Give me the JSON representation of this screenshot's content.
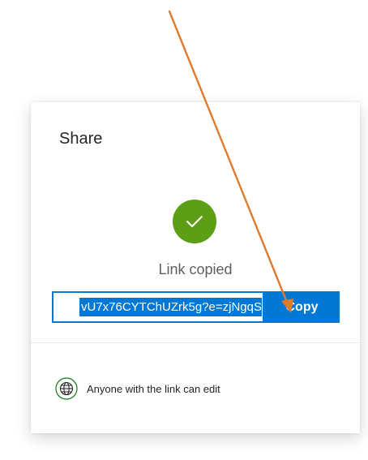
{
  "dialog": {
    "title": "Share",
    "status_text": "Link copied",
    "link_value": "vU7x76CYTChUZrk5g?e=zjNgqS",
    "copy_label": "Copy",
    "permission_text": "Anyone with the link can edit"
  },
  "icons": {
    "success": "checkmark-icon",
    "permission": "globe-icon"
  },
  "colors": {
    "accent": "#0078d4",
    "success": "#5c9e16",
    "globe": "#107c10",
    "annotation_arrow": "#e07b2e"
  }
}
